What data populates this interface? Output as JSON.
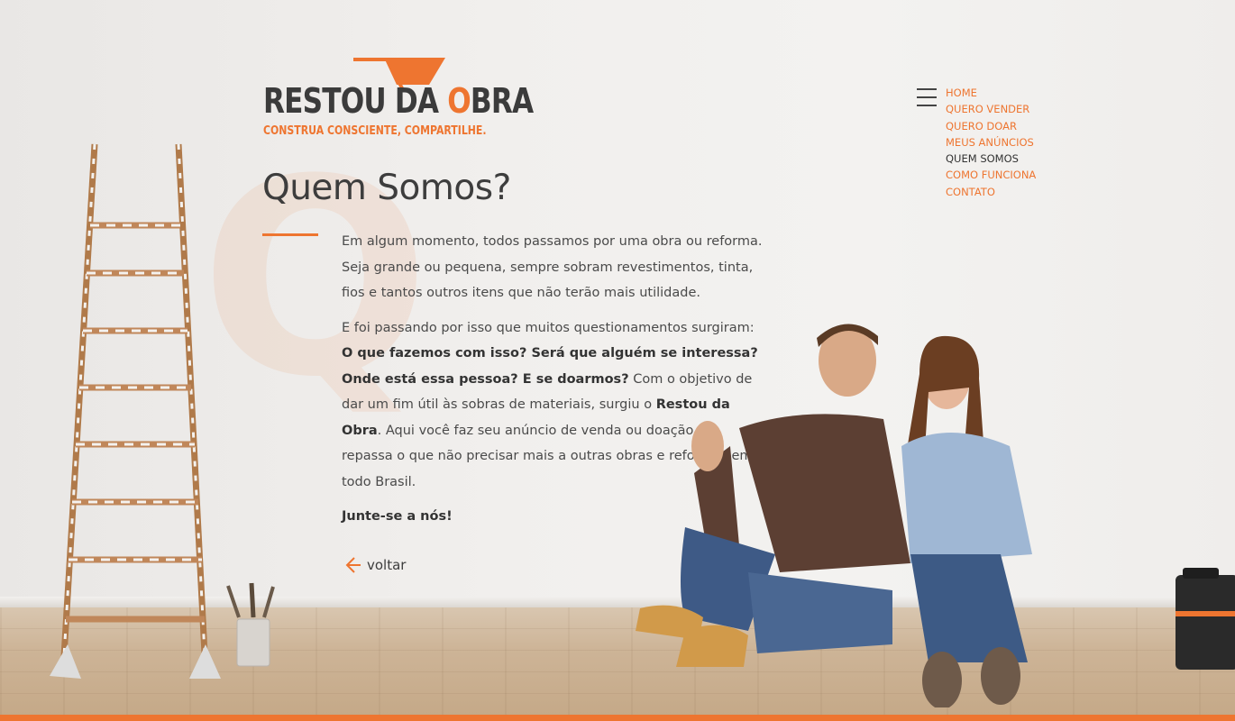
{
  "brand": {
    "name_part1": "RESTOU DA ",
    "name_o": "O",
    "name_part2": "BRA",
    "tagline": "CONSTRUA CONSCIENTE, COMPARTILHE.",
    "accent_color": "#ee7530"
  },
  "nav": {
    "menu_icon": "hamburger-icon",
    "items": [
      {
        "label": "HOME",
        "active": false
      },
      {
        "label": "QUERO VENDER",
        "active": false
      },
      {
        "label": "QUERO DOAR",
        "active": false
      },
      {
        "label": "MEUS ANÚNCIOS",
        "active": false
      },
      {
        "label": "QUEM SOMOS",
        "active": true
      },
      {
        "label": "COMO FUNCIONA",
        "active": false
      },
      {
        "label": "CONTATO",
        "active": false
      }
    ]
  },
  "page": {
    "title": "Quem Somos?",
    "bg_letter": "Q",
    "para1": "Em algum momento, todos passamos por uma obra ou reforma. Seja grande ou pequena, sempre sobram revestimentos, tinta, fios e tantos outros itens que não terão mais utilidade.",
    "para2_intro": "E foi passando por isso que muitos questionamentos surgiram: ",
    "para2_bold1": "O que fazemos com isso? Será que alguém se interessa? Onde está essa pessoa? E se doarmos?",
    "para2_mid": " Com o objetivo de dar um fim útil às sobras de materiais, surgiu o ",
    "para2_bold2": "Restou da Obra",
    "para2_end": ". Aqui você faz seu anúncio de venda ou doação e repassa o que não precisar mais a outras obras e reformas em todo Brasil.",
    "cta": "Junte-se a nós!",
    "back_label": "voltar"
  }
}
